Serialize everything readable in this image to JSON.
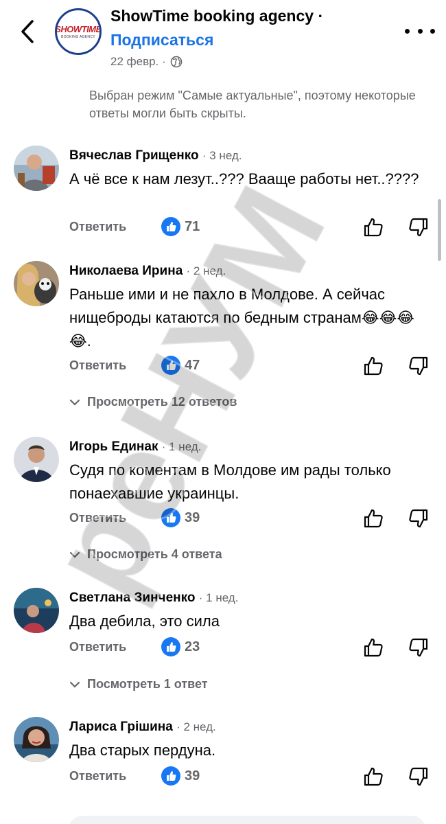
{
  "header": {
    "page_name": "ShowTime booking agency ·",
    "subscribe_label": "Подписаться",
    "date": "22 февр. ·",
    "logo_main": "SHOWTIME",
    "logo_sub": "BOOKING AGENCY"
  },
  "filter_note": "Выбран режим \"Самые актуальные\", поэтому некоторые ответы могли быть скрыты.",
  "reply_label": "Ответить",
  "comments": [
    {
      "author": "Вячеслав Грищенко",
      "time": "· 3 нед.",
      "text": "А чё все к нам лезут..??? Вааще работы нет..????",
      "likes": "71"
    },
    {
      "author": "Николаева Ирина",
      "time": "· 2 нед.",
      "text": "Раньше ими и не пахло в Молдове. А сейчас нищеброды катаются по бедным странам😂😂😂😂.",
      "likes": "47",
      "replies": "Просмотреть 12 ответов"
    },
    {
      "author": "Игорь Единак",
      "time": "· 1 нед.",
      "text": "Судя по коментам в Молдове им рады только понаехавшие украинцы.",
      "likes": "39",
      "replies": "Просмотреть 4 ответа"
    },
    {
      "author": "Светлана Зинченко",
      "time": "· 1 нед.",
      "text": "Два дебила, это сила",
      "likes": "23",
      "replies": "Посмотреть 1 ответ"
    },
    {
      "author": "Лариса Грішина",
      "time": "· 2 нед.",
      "text": "Два старых пердуна.",
      "likes": "39"
    }
  ],
  "watermark": "реНУМ",
  "colors": {
    "accent": "#1b74e4",
    "like_badge": "#1877f2",
    "secondary_text": "#65676b"
  }
}
